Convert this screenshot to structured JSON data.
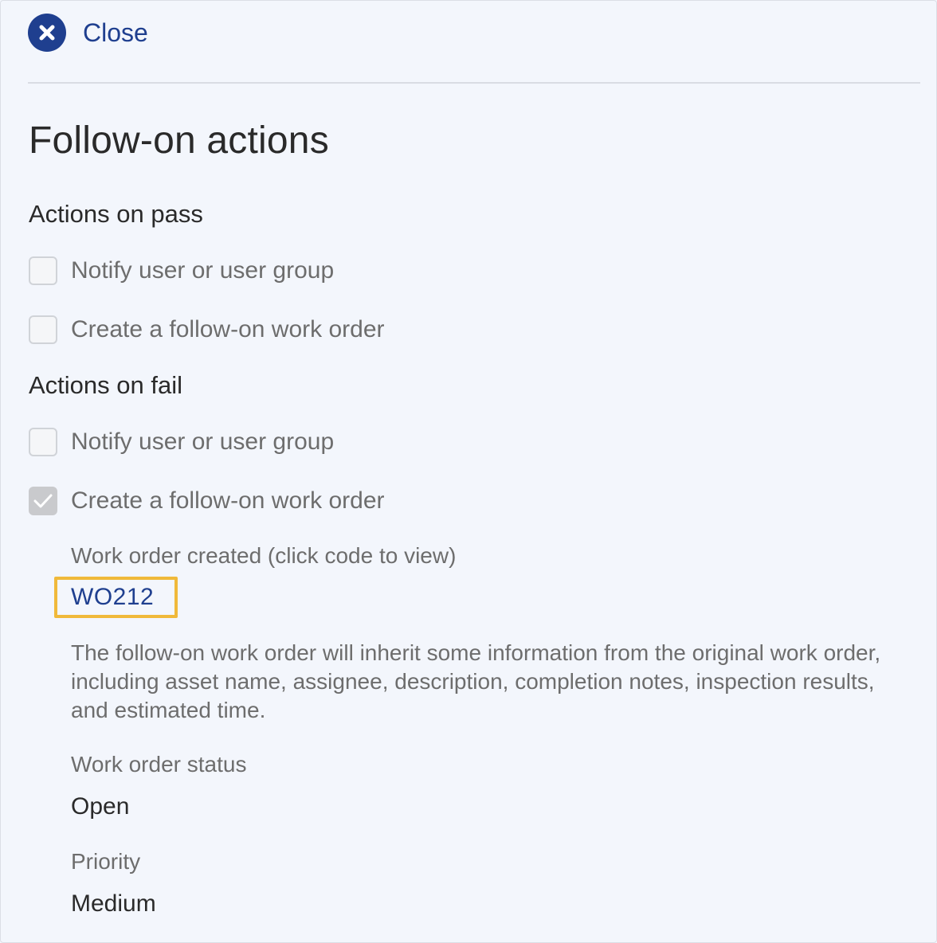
{
  "header": {
    "close_label": "Close"
  },
  "page": {
    "title": "Follow-on actions"
  },
  "pass_section": {
    "heading": "Actions on pass",
    "options": [
      {
        "label": "Notify user or user group",
        "checked": false
      },
      {
        "label": "Create a follow-on work order",
        "checked": false
      }
    ]
  },
  "fail_section": {
    "heading": "Actions on fail",
    "options": [
      {
        "label": "Notify user or user group",
        "checked": false
      },
      {
        "label": "Create a follow-on work order",
        "checked": true
      }
    ]
  },
  "work_order": {
    "created_label": "Work order created (click code to view)",
    "code": "WO212",
    "info": "The follow-on work order will inherit some information from the original work order, including asset name, assignee, description, completion notes, inspection results, and estimated time.",
    "status_label": "Work order status",
    "status_value": "Open",
    "priority_label": "Priority",
    "priority_value": "Medium"
  },
  "colors": {
    "accent": "#1f3f8f",
    "highlight": "#f0b93a",
    "background": "#f3f6fc"
  }
}
